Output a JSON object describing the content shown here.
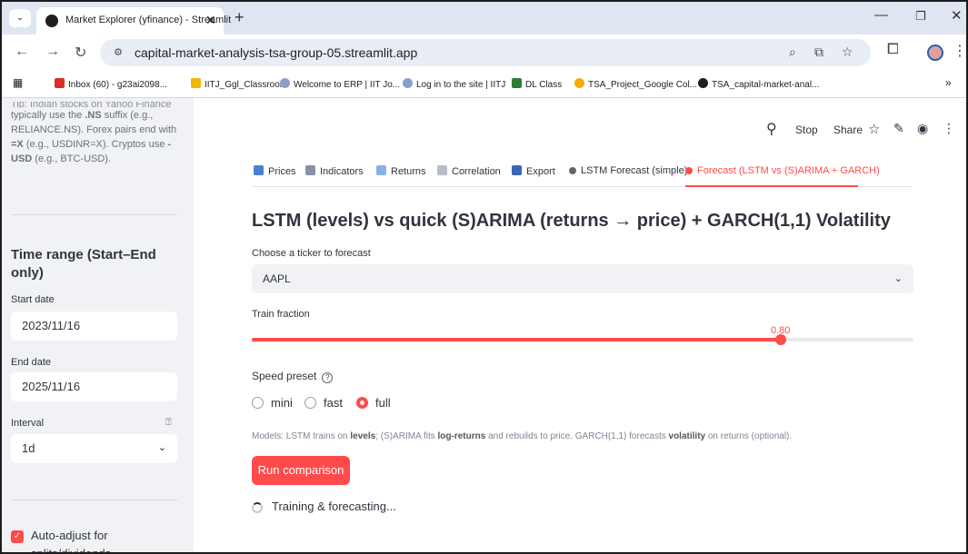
{
  "browser": {
    "tab_title": "Market Explorer (yfinance) - Streamlit",
    "url": "capital-market-analysis-tsa-group-05.streamlit.app",
    "bookmarks": [
      "Inbox (60) - g23ai2098...",
      "IITJ_Ggl_Classroom",
      "Welcome to ERP | IIT Jo...",
      "Log in to the site | IITJ",
      "DL Class",
      "TSA_Project_Google Col...",
      "TSA_capital-market-anal..."
    ]
  },
  "sidebar": {
    "tip_cut": "Tip: Indian stocks on Yahoo Finance",
    "tip": {
      "a": "typically use the ",
      "b": ".NS",
      "c": " suffix (e.g., RELIANCE.NS). Forex pairs end with ",
      "d": "=X",
      "e": " (e.g., USDINR=X). Cryptos use ",
      "f": "-USD",
      "g": " (e.g., BTC-USD)."
    },
    "time_range_title": "Time range (Start–End only)",
    "start_label": "Start date",
    "start_value": "2023/11/16",
    "end_label": "End date",
    "end_value": "2025/11/16",
    "interval_label": "Interval",
    "interval_value": "1d",
    "auto_adjust_label": "Auto-adjust for splits/dividends",
    "auto_adjust_checked": true
  },
  "header": {
    "stop": "Stop",
    "share": "Share"
  },
  "tabs": [
    {
      "label": "Prices",
      "color": "#4a7fd6"
    },
    {
      "label": "Indicators",
      "color": "#8a8fa8"
    },
    {
      "label": "Returns",
      "color": "#8ab0e8"
    },
    {
      "label": "Correlation",
      "color": "#b8bcc8"
    },
    {
      "label": "Export",
      "color": "#3a66b8"
    },
    {
      "label": "LSTM Forecast (simple)",
      "color": "#666666"
    },
    {
      "label": "Forecast (LSTM vs (S)ARIMA + GARCH)",
      "color": "#ff4b4b"
    }
  ],
  "main": {
    "title": "LSTM (levels) vs quick (S)ARIMA (returns → price) + GARCH(1,1) Volatility",
    "ticker_label": "Choose a ticker to forecast",
    "ticker_value": "AAPL",
    "train_label": "Train fraction",
    "train_value": "0.80",
    "train_fraction": 0.8,
    "speed_label": "Speed preset",
    "speed_options": [
      "mini",
      "fast",
      "full"
    ],
    "speed_selected": "full",
    "caption": {
      "a": "Models: LSTM trains on ",
      "b": "levels",
      "c": "; (S)ARIMA fits ",
      "d": "log-returns",
      "e": " and rebuilds to price. GARCH(1,1) forecasts ",
      "f": "volatility",
      "g": " on returns (optional)."
    },
    "run_button": "Run comparison",
    "status": "Training & forecasting..."
  },
  "accent_color": "#ff4b4b"
}
